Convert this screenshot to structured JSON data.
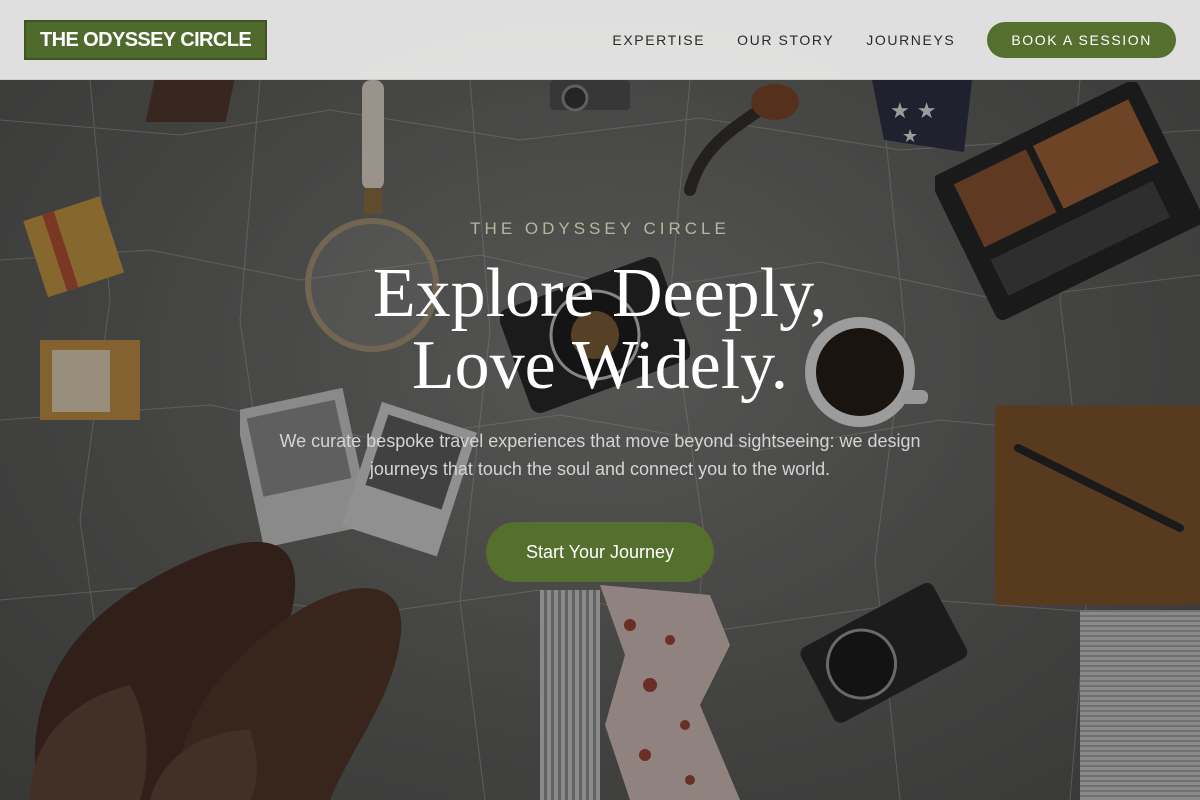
{
  "header": {
    "logo_text": "THE ODYSSEY CIRCLE",
    "nav": [
      {
        "label": "EXPERTISE"
      },
      {
        "label": "OUR STORY"
      },
      {
        "label": "JOURNEYS"
      }
    ],
    "cta_label": "BOOK A SESSION"
  },
  "hero": {
    "eyebrow": "THE ODYSSEY CIRCLE",
    "headline_line1": "Explore Deeply,",
    "headline_line2": "Love Widely.",
    "subtext": "We curate bespoke travel experiences that move beyond sightseeing: we design journeys that touch the soul and connect you to the world.",
    "cta_label": "Start Your Journey"
  },
  "colors": {
    "brand_green": "#556f2e",
    "logo_green": "#4f6a2c",
    "eyebrow_tint": "#b3b89c",
    "header_bg": "#ececec"
  },
  "background_image": {
    "icons": [
      "map-texture",
      "boots-icon",
      "camera-icon",
      "coffee-cup-icon",
      "magnifying-glass-icon",
      "notebook-icon",
      "pen-icon",
      "pipe-icon",
      "film-box-icon",
      "instant-camera-icon",
      "photos-icon",
      "scarf-icon"
    ]
  }
}
